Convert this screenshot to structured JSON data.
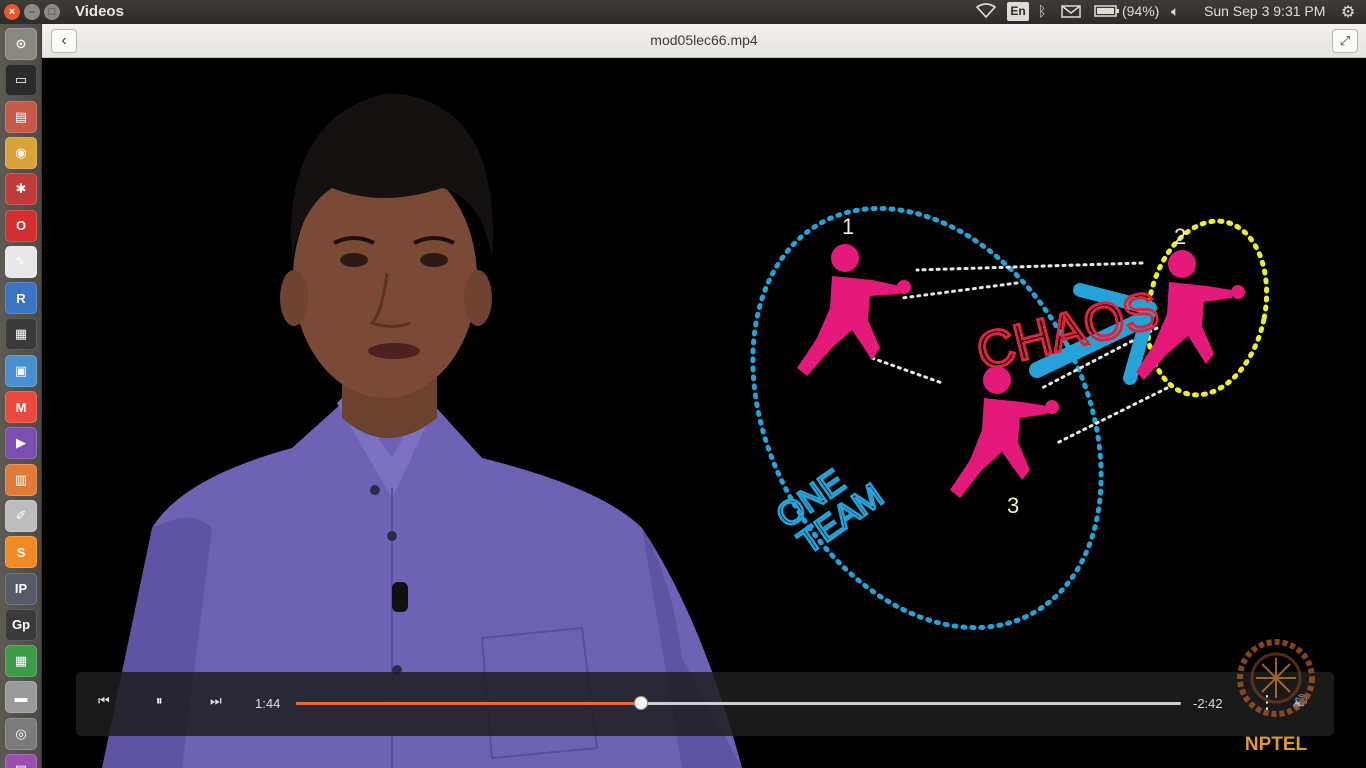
{
  "top_panel": {
    "app_title": "Videos",
    "keyboard_layout": "En",
    "battery": "(94%)",
    "datetime": "Sun Sep  3  9:31 PM",
    "close_glyph": "×",
    "min_glyph": "–",
    "max_glyph": "□"
  },
  "launcher": {
    "items": [
      {
        "name": "dash-home",
        "label": "⊙",
        "color": "#8a8680"
      },
      {
        "name": "terminal",
        "label": "▭",
        "color": "#2b2b2b"
      },
      {
        "name": "files",
        "label": "▤",
        "color": "#c65a4a"
      },
      {
        "name": "chrome",
        "label": "◉",
        "color": "#d9a23a"
      },
      {
        "name": "settings-tool",
        "label": "✱",
        "color": "#c23b3b"
      },
      {
        "name": "opera",
        "label": "O",
        "color": "#d32f2f"
      },
      {
        "name": "reader",
        "label": "✎",
        "color": "#e8e8e8"
      },
      {
        "name": "r-language",
        "label": "R",
        "color": "#3a74c2"
      },
      {
        "name": "video-editor",
        "label": "▦",
        "color": "#3a3a3a"
      },
      {
        "name": "document",
        "label": "▣",
        "color": "#4a8fd0"
      },
      {
        "name": "gmail",
        "label": "M",
        "color": "#e94a3f"
      },
      {
        "name": "media-player",
        "label": "▶",
        "color": "#7a4fb0"
      },
      {
        "name": "presentation",
        "label": "▥",
        "color": "#e07b3a"
      },
      {
        "name": "text-editor",
        "label": "✐",
        "color": "#bdbdbd"
      },
      {
        "name": "sublime",
        "label": "S",
        "color": "#f08a24"
      },
      {
        "name": "ipython",
        "label": "IP",
        "color": "#555a66"
      },
      {
        "name": "gp",
        "label": "Gp",
        "color": "#3a3a3a"
      },
      {
        "name": "spreadsheet",
        "label": "▦",
        "color": "#3e9b4a"
      },
      {
        "name": "drive",
        "label": "▬",
        "color": "#9a9a9a"
      },
      {
        "name": "disk",
        "label": "◎",
        "color": "#7a7a7a"
      },
      {
        "name": "misc",
        "label": "▤",
        "color": "#9a4fb0"
      }
    ]
  },
  "header": {
    "file_title": "mod05lec66.mp4",
    "back_glyph": "‹",
    "fullscreen_glyph": "⤢"
  },
  "video": {
    "whiteboard": {
      "chaos_text": "CHAOS",
      "one_text": "ONE",
      "team_text": "TEAM",
      "label_1": "1",
      "label_2": "2",
      "label_3": "3"
    },
    "watermark": "NPTEL"
  },
  "controls": {
    "elapsed": "1:44",
    "remaining": "-2:42",
    "progress_fraction": 0.39,
    "prev_glyph": "⏮",
    "pause_glyph": "⏸",
    "next_glyph": "⏭",
    "menu_glyph": "⋮",
    "volume_glyph": "🔊"
  },
  "colors": {
    "accent_progress": "#e86a3a",
    "chaos_red": "#e0243c",
    "team_blue": "#25a3d8",
    "team2_yellow": "#ecef2a",
    "figure_pink": "#e5197a"
  }
}
